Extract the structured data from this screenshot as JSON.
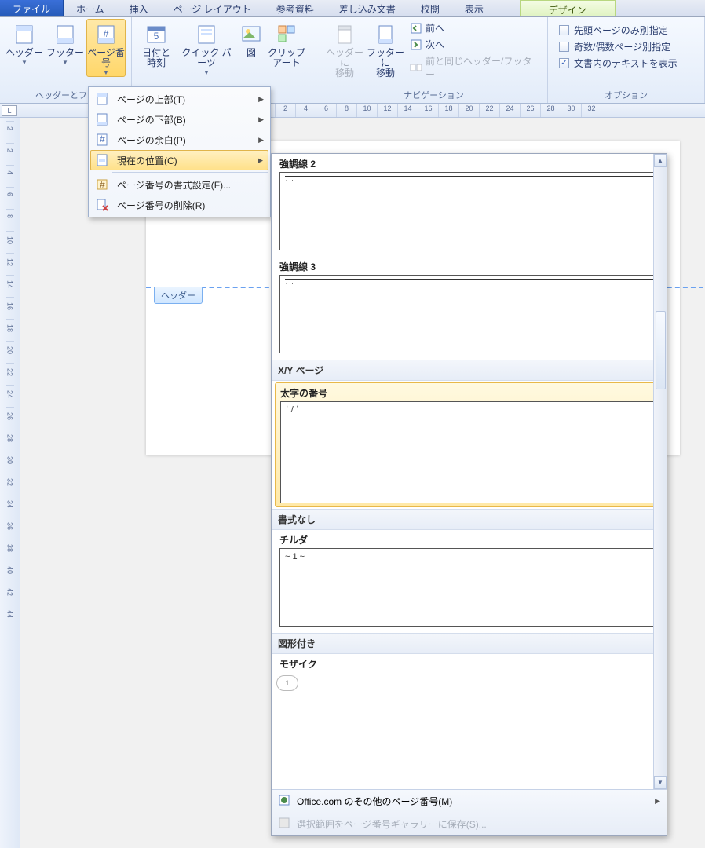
{
  "tabs": {
    "file": "ファイル",
    "home": "ホーム",
    "insert": "挿入",
    "layout": "ページ レイアウト",
    "references": "参考資料",
    "mailings": "差し込み文書",
    "review": "校閲",
    "view": "表示",
    "design": "デザイン"
  },
  "ribbon": {
    "header": "ヘッダー",
    "footer": "フッター",
    "pagenum": "ページ番号",
    "group_hf": "ヘッダーとフッ",
    "datetime_l1": "日付と",
    "datetime_l2": "時刻",
    "quickparts": "クイック パーツ",
    "picture": "図",
    "clipart_l1": "クリップ",
    "clipart_l2": "アート",
    "goto_header_l1": "ヘッダーに",
    "goto_header_l2": "移動",
    "goto_footer_l1": "フッターに",
    "goto_footer_l2": "移動",
    "prev": "前へ",
    "next": "次へ",
    "link_prev": "前と同じヘッダー/フッター",
    "group_nav": "ナビゲーション",
    "opt_firstpage": "先頭ページのみ別指定",
    "opt_oddeven": "奇数/偶数ページ別指定",
    "opt_showtext": "文書内のテキストを表示",
    "group_opts": "オプション"
  },
  "menu": {
    "top": "ページの上部(T)",
    "bottom": "ページの下部(B)",
    "margins": "ページの余白(P)",
    "current": "現在の位置(C)",
    "format": "ページ番号の書式設定(F)...",
    "remove": "ページ番号の削除(R)"
  },
  "gallery": {
    "accent2": "強調線 2",
    "accent2_sample": "ˈ ˈ",
    "accent3": "強調線 3",
    "accent3_sample": "ˈ ˈ",
    "cat_xy": "X/Y ページ",
    "bold": "太字の番号",
    "bold_sample": "ˈ / ˈ",
    "cat_plain": "書式なし",
    "tilde": "チルダ",
    "tilde_sample": "~ 1 ~",
    "cat_shape": "図形付き",
    "mosaic": "モザイク",
    "foot_office": "Office.com のその他のページ番号(M)",
    "foot_save": "選択範囲をページ番号ギャラリーに保存(S)..."
  },
  "doc": {
    "header_tag": "ヘッダー"
  },
  "ruler_h": [
    "2",
    "4",
    "6",
    "8",
    "10",
    "12",
    "14",
    "16",
    "18",
    "20",
    "22",
    "24",
    "26",
    "28",
    "30",
    "32"
  ],
  "ruler_v": [
    "2",
    "2",
    "4",
    "6",
    "8",
    "10",
    "12",
    "14",
    "16",
    "18",
    "20",
    "22",
    "24",
    "26",
    "28",
    "30",
    "32",
    "34",
    "36",
    "38",
    "40",
    "42",
    "44"
  ]
}
